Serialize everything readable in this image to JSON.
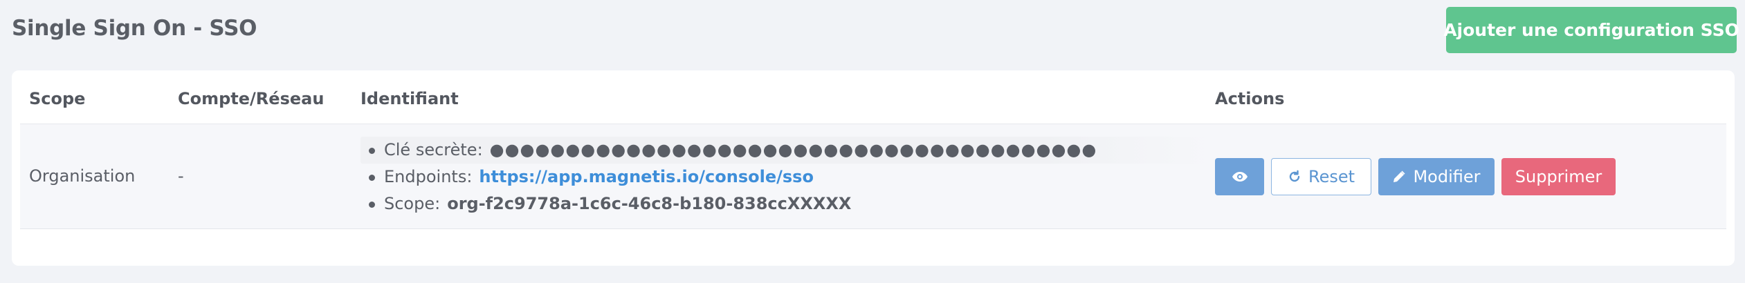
{
  "header": {
    "title": "Single Sign On - SSO",
    "add_button_label": "Ajouter une configuration SSO"
  },
  "table": {
    "columns": [
      "Scope",
      "Compte/Réseau",
      "Identifiant",
      "Actions"
    ],
    "rows": [
      {
        "scope": "Organisation",
        "account": "-",
        "identifier": {
          "secret_label": "Clé secrète:",
          "secret_value": "●●●●●●●●●●●●●●●●●●●●●●●●●●●●●●●●●●●●●●●●",
          "endpoints_label": "Endpoints:",
          "endpoints_value": "https://app.magnetis.io/console/sso",
          "scope_label": "Scope:",
          "scope_value": "org-f2c9778a-1c6c-46c8-b180-838ccXXXXX"
        },
        "actions": {
          "view_icon": "eye-icon",
          "reset_icon": "refresh-icon",
          "reset_label": "Reset",
          "edit_icon": "pencil-icon",
          "edit_label": "Modifier",
          "delete_label": "Supprimer"
        }
      }
    ]
  },
  "colors": {
    "primary_green": "#5fc58f",
    "primary_blue": "#6ea1d9",
    "danger": "#e8687c",
    "link": "#3e8ed9"
  }
}
